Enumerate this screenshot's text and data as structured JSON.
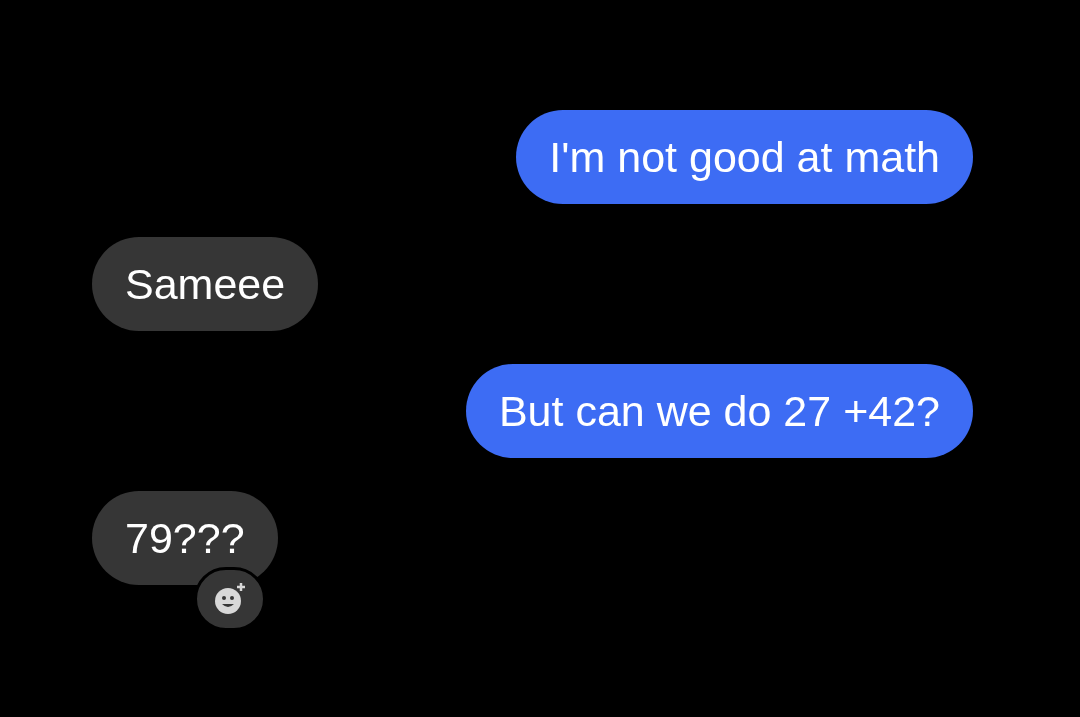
{
  "messages": [
    {
      "kind": "sent",
      "text": "I'm not good at math",
      "add_reaction": false
    },
    {
      "kind": "received",
      "text": "Sameee",
      "add_reaction": false
    },
    {
      "kind": "sent",
      "text": "But can we do 27 +42?",
      "add_reaction": false
    },
    {
      "kind": "received",
      "text": "79???",
      "add_reaction": true
    }
  ]
}
